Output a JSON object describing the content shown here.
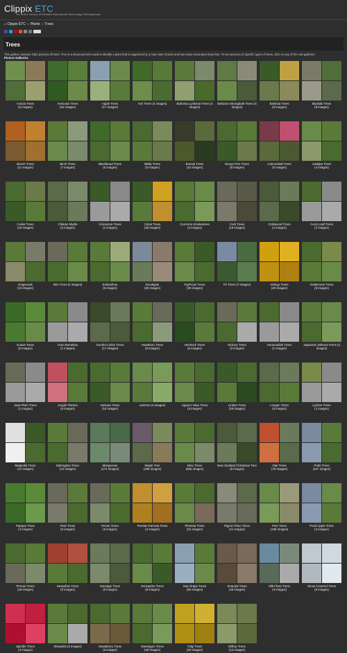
{
  "header": {
    "logo_main": "Clippix",
    "logo_accent": " ETC",
    "tagline": "An online service of Florida's Educational Technology Clearinghouse"
  },
  "breadcrumb": [
    "Clippix ETC",
    "Plants",
    "Trees"
  ],
  "share_colors": [
    "#3b5998",
    "#1da1f2",
    "#bd081c",
    "#e4572e",
    "#8a8a8a",
    "#777",
    "#ddd"
  ],
  "page": {
    "title": "Trees",
    "intro": "This gallery contains 2351 pictures of trees. Tree is a structural term used to identify a plant that is supported by a main stem (trunk) and has many secondary branches. To see pictures of specific types of trees, click on any of the sub-galleries.",
    "section": "Picture Galleries"
  },
  "galleries": [
    {
      "name": "Acacia Trees",
      "count": "(6 images)",
      "colors": [
        "#6e8f4e",
        "#8a7a5a",
        "#4f6e3a",
        "#9aa070"
      ]
    },
    {
      "name": "Aesculus Trees",
      "count": "(15 images)",
      "colors": [
        "#3f6b2e",
        "#5a7f3a",
        "#2f5a22",
        "#6d8a4a"
      ]
    },
    {
      "name": "Apple Trees",
      "count": "(17 images)",
      "colors": [
        "#8aa0b0",
        "#6a8a4a",
        "#9ab07a",
        "#5a7a3a"
      ]
    },
    {
      "name": "Ash Trees (4 images)",
      "count": "",
      "colors": [
        "#3f6a2a",
        "#577a36",
        "#6d8d48",
        "#4b6c31"
      ]
    },
    {
      "name": "Bahama Lysiloma Trees (4 images)",
      "count": "",
      "colors": [
        "#5a7a3a",
        "#7a8a6a",
        "#8f9f6f",
        "#4a6a2a"
      ]
    },
    {
      "name": "Bahama Strongbark Trees (5 images)",
      "count": "",
      "colors": [
        "#5f7a45",
        "#8a8a7a",
        "#6b8a4a",
        "#4a5a3a"
      ]
    },
    {
      "name": "Banksia Trees",
      "count": "(8 images)",
      "colors": [
        "#3a5a2a",
        "#c0a040",
        "#6a7a4a",
        "#8a8a5a"
      ]
    },
    {
      "name": "Baobab Trees",
      "count": "(9 images)",
      "colors": [
        "#7a7a6a",
        "#4f6e3a",
        "#9a9a8a",
        "#5a6a4a"
      ]
    },
    {
      "name": "Beech Trees",
      "count": "(11 images)",
      "colors": [
        "#b06020",
        "#c08030",
        "#7a5a30",
        "#a07030"
      ]
    },
    {
      "name": "Birch Trees",
      "count": "(7 images)",
      "colors": [
        "#5a7a3a",
        "#8a9a7a",
        "#6a8a4a",
        "#7a8a6a"
      ]
    },
    {
      "name": "Blackbead Trees",
      "count": "(5 images)",
      "colors": [
        "#3f6a2a",
        "#5a7a3a",
        "#4a6a30",
        "#6a8a4a"
      ]
    },
    {
      "name": "Blolly Trees",
      "count": "(5 images)",
      "colors": [
        "#4a6a30",
        "#7a8a5a",
        "#5a7a3a",
        "#6a7a4a"
      ]
    },
    {
      "name": "Bonsai Trees",
      "count": "(10 images)",
      "colors": [
        "#3a3a2a",
        "#5a6a3a",
        "#4a5a2a",
        "#2a3a20"
      ]
    },
    {
      "name": "Bunya Pine Trees",
      "count": "(8 images)",
      "colors": [
        "#4a6a30",
        "#5a7a3a",
        "#3a5a28",
        "#6a7a4a"
      ]
    },
    {
      "name": "Cannonball Trees",
      "count": "(6 images)",
      "colors": [
        "#7a3a4a",
        "#c05070",
        "#5a6a3a",
        "#4a5a30"
      ]
    },
    {
      "name": "Catalpa Trees",
      "count": "(4 images)",
      "colors": [
        "#6a8a4a",
        "#5a7a3a",
        "#8a9a6a",
        "#4a6a30"
      ]
    },
    {
      "name": "Cedar Trees",
      "count": "(16 images)",
      "colors": [
        "#4a6a30",
        "#6a7a4a",
        "#3a5a28",
        "#5a7a3a"
      ]
    },
    {
      "name": "Chilean Myrtle",
      "count": "(6 images)",
      "colors": [
        "#5a6a4a",
        "#7a8a6a",
        "#4a5a3a",
        "#6a7a5a"
      ]
    },
    {
      "name": "Cinnamon Trees",
      "count": "(1 images)",
      "colors": [
        "#3a5a28",
        "#8a8a8a",
        "#9a9a9a",
        "#aaaaaa"
      ]
    },
    {
      "name": "Citrus Trees",
      "count": "(38 images)",
      "colors": [
        "#3a5a28",
        "#d0a020",
        "#5a7a3a",
        "#c09030"
      ]
    },
    {
      "name": "Common Smoketrees",
      "count": "(4 images)",
      "colors": [
        "#5a7a3a",
        "#6a8a4a",
        "#4a6a30",
        "#7a9a5a"
      ]
    },
    {
      "name": "Cork Trees",
      "count": "(18 images)",
      "colors": [
        "#6a6a5a",
        "#5a5a4a",
        "#7a7a6a",
        "#4a4a3a"
      ]
    },
    {
      "name": "Crabwood Trees",
      "count": "(4 images)",
      "colors": [
        "#4a5a3a",
        "#6a7a5a",
        "#5a6a4a",
        "#3a4a2a"
      ]
    },
    {
      "name": "Curry Leaf Trees",
      "count": "(1 images)",
      "colors": [
        "#4a6a30",
        "#8a8a8a",
        "#9a9a9a",
        "#aaaaaa"
      ]
    },
    {
      "name": "Dogwoods",
      "count": "(13 images)",
      "colors": [
        "#5a7a3a",
        "#7a7a6a",
        "#8a8a6a",
        "#4a6a30"
      ]
    },
    {
      "name": "Elm Trees (5 images)",
      "count": "",
      "colors": [
        "#6a6a5a",
        "#5a7a3a",
        "#4a6a30",
        "#6a8a4a"
      ]
    },
    {
      "name": "Enkianthus",
      "count": "(5 images)",
      "colors": [
        "#5a7a3a",
        "#9aaa7a",
        "#4a6a30",
        "#6a8a4a"
      ]
    },
    {
      "name": "Eucalypts",
      "count": "(26 images)",
      "colors": [
        "#7a8a9a",
        "#8a7a6a",
        "#6a7a5a",
        "#9a8a7a"
      ]
    },
    {
      "name": "Fig/Ficus Trees",
      "count": "(39 images)",
      "colors": [
        "#5a7a3a",
        "#3a5a28",
        "#6a8a4a",
        "#4a6a30"
      ]
    },
    {
      "name": "Fir Trees (7 images)",
      "count": "",
      "colors": [
        "#7a8aa0",
        "#4a6a40",
        "#3a5a30",
        "#5a7a50"
      ]
    },
    {
      "name": "Ginkgo Trees",
      "count": "(20 images)",
      "colors": [
        "#d0a010",
        "#e0b020",
        "#c09010",
        "#b08010"
      ]
    },
    {
      "name": "Goldenrain Trees",
      "count": "(8 images)",
      "colors": [
        "#4a6a30",
        "#7a8a4a",
        "#5a7a3a",
        "#6a8a4a"
      ]
    },
    {
      "name": "Guava Trees",
      "count": "(6 images)",
      "colors": [
        "#3a6a28",
        "#5a8a3a",
        "#4a7a30",
        "#6a8a4a"
      ]
    },
    {
      "name": "Gum Bumelias",
      "count": "(1 images)",
      "colors": [
        "#5a7a3a",
        "#8a8a8a",
        "#9a9a9a",
        "#aaaaaa"
      ]
    },
    {
      "name": "Gumbo-Limbo Trees",
      "count": "(17 images)",
      "colors": [
        "#3a4a2a",
        "#6a7a5a",
        "#5a6a4a",
        "#4a5a3a"
      ]
    },
    {
      "name": "Hawthorn Trees",
      "count": "(9 images)",
      "colors": [
        "#5a7a3a",
        "#6a6a5a",
        "#4a6a30",
        "#8a9a7a"
      ]
    },
    {
      "name": "Hemlock Trees",
      "count": "(6 images)",
      "colors": [
        "#3a5a28",
        "#4a6a30",
        "#2a4a20",
        "#5a7a3a"
      ]
    },
    {
      "name": "Hickory Trees",
      "count": "(3 images)",
      "colors": [
        "#6a6a5a",
        "#5a7a3a",
        "#4a6a30",
        "#aaaaaa"
      ]
    },
    {
      "name": "Horseradish Trees",
      "count": "(1 images)",
      "colors": [
        "#4a6a30",
        "#8a8a8a",
        "#9a9a9a",
        "#aaaaaa"
      ]
    },
    {
      "name": "Japanese Zelkova Trees (4 images)",
      "count": "",
      "colors": [
        "#5a7a3a",
        "#6a8a4a",
        "#4a6a30",
        "#7a9a5a"
      ]
    },
    {
      "name": "Java Plum Trees",
      "count": "(1 images)",
      "colors": [
        "#6a6a5a",
        "#8a8a8a",
        "#9a9a9a",
        "#aaaaaa"
      ]
    },
    {
      "name": "Jungle Flames",
      "count": "(6 images)",
      "colors": [
        "#c05060",
        "#4a6a30",
        "#d07080",
        "#5a7a3a"
      ]
    },
    {
      "name": "Katsura Trees",
      "count": "(15 images)",
      "colors": [
        "#4a6a30",
        "#5a7a3a",
        "#3a5a28",
        "#6a8a4a"
      ]
    },
    {
      "name": "Larches (4 images)",
      "count": "",
      "colors": [
        "#6a8a4a",
        "#7a9a5a",
        "#5a7a3a",
        "#8aaa6a"
      ]
    },
    {
      "name": "Lignum Vitae Trees",
      "count": "(6 images)",
      "colors": [
        "#5a7a3a",
        "#4a6a30",
        "#6a8a4a",
        "#3a5a28"
      ]
    },
    {
      "name": "Linden Trees",
      "count": "(28 images)",
      "colors": [
        "#3a5a28",
        "#4a6a30",
        "#5a7a3a",
        "#2a4a20"
      ]
    },
    {
      "name": "Longan Trees",
      "count": "(6 images)",
      "colors": [
        "#5a6a4a",
        "#6a7a5a",
        "#4a6a30",
        "#5a7a3a"
      ]
    },
    {
      "name": "Lychee Trees",
      "count": "(1 images)",
      "colors": [
        "#7a8a4a",
        "#8a8a8a",
        "#9a9a9a",
        "#aaaaaa"
      ]
    },
    {
      "name": "Magnolia Trees",
      "count": "(12 images)",
      "colors": [
        "#e0e0e0",
        "#3a5a28",
        "#f0f0f0",
        "#4a6a30"
      ]
    },
    {
      "name": "Mahogany Trees",
      "count": "(13 images)",
      "colors": [
        "#5a7a3a",
        "#6a6a5a",
        "#4a6a30",
        "#7a7a6a"
      ]
    },
    {
      "name": "Mangroves",
      "count": "(174 images)",
      "colors": [
        "#5a7a5a",
        "#4a6a4a",
        "#6a8a6a",
        "#7a8a7a"
      ]
    },
    {
      "name": "Maple Tree",
      "count": "(189 images)",
      "colors": [
        "#6a5a6a",
        "#7a8a5a",
        "#5a6a4a",
        "#8a7a5a"
      ]
    },
    {
      "name": "Misc Trees",
      "count": "(656 images)",
      "colors": [
        "#5a7a3a",
        "#4a6a30",
        "#6a8a4a",
        "#7a8a6a"
      ]
    },
    {
      "name": "New Zealand Christmas Tree",
      "count": "(8 images)",
      "colors": [
        "#4a5a3a",
        "#5a6a4a",
        "#6a7a5a",
        "#3a4a2a"
      ]
    },
    {
      "name": "Oak Trees",
      "count": "(78 images)",
      "colors": [
        "#c05030",
        "#6a7a5a",
        "#d07040",
        "#5a6a4a"
      ]
    },
    {
      "name": "Palm Trees",
      "count": "(347 images)",
      "colors": [
        "#7a8aa0",
        "#5a7a3a",
        "#8a9ab0",
        "#4a6a30"
      ]
    },
    {
      "name": "Papaya Trees",
      "count": "(4 images)",
      "colors": [
        "#4a7a30",
        "#5a8a3a",
        "#3a6a28",
        "#6a9a4a"
      ]
    },
    {
      "name": "Pear Trees",
      "count": "(6 images)",
      "colors": [
        "#6a6a5a",
        "#5a7a3a",
        "#7a7a6a",
        "#4a6a30"
      ]
    },
    {
      "name": "Pecan Trees",
      "count": "(8 images)",
      "colors": [
        "#6a6a5a",
        "#5a7a3a",
        "#7a8a6a",
        "#4a6a30"
      ]
    },
    {
      "name": "Persian Parrotia Trees",
      "count": "(4 images)",
      "colors": [
        "#c09030",
        "#d0a040",
        "#b08020",
        "#a07020"
      ]
    },
    {
      "name": "Photinia Trees",
      "count": "(15 images)",
      "colors": [
        "#5a7a3a",
        "#4a6a30",
        "#6a8a4a",
        "#7a6a5a"
      ]
    },
    {
      "name": "Pigeon Plum Trees",
      "count": "(11 images)",
      "colors": [
        "#8a8a7a",
        "#5a6a4a",
        "#7a7a6a",
        "#6a6a5a"
      ]
    },
    {
      "name": "Pine Trees",
      "count": "(168 images)",
      "colors": [
        "#6a8a4a",
        "#9a9a7a",
        "#7a9a5a",
        "#8a8a6a"
      ]
    },
    {
      "name": "Pond Apple Trees",
      "count": "(4 images)",
      "colors": [
        "#7a8aa0",
        "#6a8a4a",
        "#8a9ab0",
        "#5a7a3a"
      ]
    },
    {
      "name": "Prunus Trees",
      "count": "(18 images)",
      "colors": [
        "#4a6a30",
        "#5a7a3a",
        "#6a6a5a",
        "#7a8a6a"
      ]
    },
    {
      "name": "Sassafras Trees",
      "count": "(9 images)",
      "colors": [
        "#a04030",
        "#b05040",
        "#5a7a3a",
        "#4a6a30"
      ]
    },
    {
      "name": "Sausage Trees",
      "count": "(9 images)",
      "colors": [
        "#6a7a5a",
        "#5a6a4a",
        "#7a8a6a",
        "#4a5a3a"
      ]
    },
    {
      "name": "Screwpine Trees",
      "count": "(9 images)",
      "colors": [
        "#4a6a30",
        "#5a7a3a",
        "#6a8a4a",
        "#3a5a28"
      ]
    },
    {
      "name": "Sea Grape Trees",
      "count": "(55 images)",
      "colors": [
        "#8aa0b0",
        "#5a7a3a",
        "#9ab0c0",
        "#6a8a4a"
      ]
    },
    {
      "name": "Sequoia Trees",
      "count": "(45 images)",
      "colors": [
        "#6a5a4a",
        "#7a6a5a",
        "#5a4a3a",
        "#8a7a6a"
      ]
    },
    {
      "name": "Silk Floss Trees",
      "count": "(3 images)",
      "colors": [
        "#6a8aa0",
        "#7a8a7a",
        "#5a6a5a",
        "#aaaaaa"
      ]
    },
    {
      "name": "Snow Covered Trees",
      "count": "(6 images)",
      "colors": [
        "#c0c8d0",
        "#d0d8e0",
        "#b0b8c0",
        "#e0e8f0"
      ]
    },
    {
      "name": "Spindle Trees",
      "count": "(4 images)",
      "colors": [
        "#d03050",
        "#c02040",
        "#b01030",
        "#e04060"
      ]
    },
    {
      "name": "Stewartia (3 images)",
      "count": "",
      "colors": [
        "#5a7a3a",
        "#4a6a30",
        "#6a8a4a",
        "#aaaaaa"
      ]
    },
    {
      "name": "Strawberry Trees",
      "count": "(5 images)",
      "colors": [
        "#4a6a30",
        "#5a7a3a",
        "#7a6a4a",
        "#6a5a3a"
      ]
    },
    {
      "name": "Sweetgum Trees",
      "count": "(28 images)",
      "colors": [
        "#5a7a3a",
        "#6a8a4a",
        "#4a6a30",
        "#7a9a5a"
      ]
    },
    {
      "name": "Tulip Trees",
      "count": "(20 images)",
      "colors": [
        "#c0a020",
        "#d0b030",
        "#b09010",
        "#a08010"
      ]
    },
    {
      "name": "Willow Trees",
      "count": "(13 images)",
      "colors": [
        "#7a8a5a",
        "#6a7a4a",
        "#8a9a6a",
        "#5a6a3a"
      ]
    }
  ]
}
